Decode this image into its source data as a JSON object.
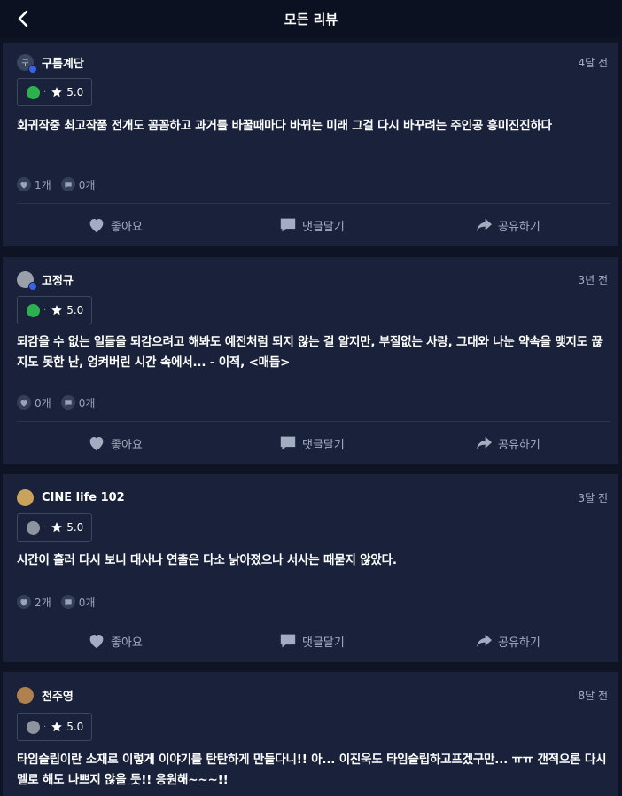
{
  "header": {
    "title": "모든 리뷰"
  },
  "reviews": [
    {
      "username": "구름계단",
      "avatar_text": "구",
      "time": "4달 전",
      "rating_dot_color": "#2bb24c",
      "score": "5.0",
      "content": "회귀작중 최고작품 전개도 꼼꼼하고 과거를 바꿀때마다 바뀌는 미래 그걸 다시 바꾸려는 주인공 흥미진진하다",
      "likes": "1개",
      "comments": "0개"
    },
    {
      "username": "고정규",
      "avatar_text": "",
      "time": "3년 전",
      "rating_dot_color": "#2bb24c",
      "score": "5.0",
      "content": "되감을 수 없는 일들을 되감으려고 해봐도 예전처럼 되지 않는 걸 알지만, 부질없는 사랑, 그대와 나눈 약속을 맺지도 끊지도 못한 난, 엉켜버린 시간 속에서... - 이적, <매듭>",
      "likes": "0개",
      "comments": "0개"
    },
    {
      "username": "CINE life 102",
      "avatar_text": "",
      "time": "3달 전",
      "rating_dot_color": "#8e949e",
      "score": "5.0",
      "content": "시간이 흘러 다시 보니 대사나 연출은 다소 낡아졌으나 서사는 때묻지 않았다.",
      "likes": "2개",
      "comments": "0개"
    },
    {
      "username": "천주영",
      "avatar_text": "",
      "time": "8달 전",
      "rating_dot_color": "#8e949e",
      "score": "5.0",
      "content": "타임슬립이란 소재로 이렇게 이야기를 탄탄하게 만들다니!! 아... 이진욱도 타임슬립하고프겠구만... ㅠㅠ 갠적으론 다시 멜로 해도 나쁘지 않을 듯!! 응원해~~~!!",
      "likes": "",
      "comments": ""
    }
  ],
  "actions": {
    "like": "좋아요",
    "comment": "댓글달기",
    "share": "공유하기"
  },
  "icons": {
    "back": "chevron-left-icon",
    "star": "star-icon",
    "heart": "heart-icon",
    "comment": "speech-bubble-icon",
    "share": "share-arrow-icon"
  }
}
